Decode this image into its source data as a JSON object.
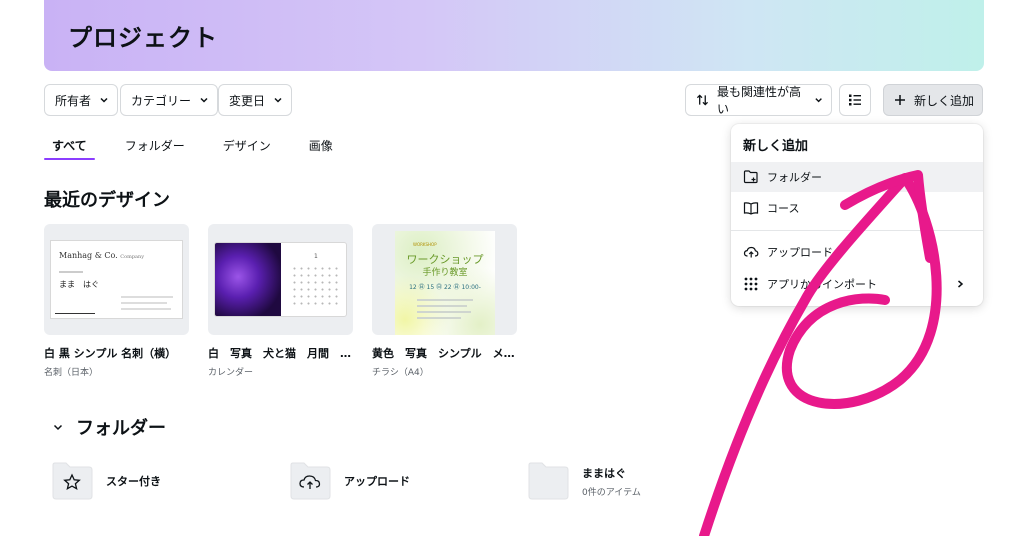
{
  "header": {
    "title": "プロジェクト"
  },
  "filters": {
    "owner": "所有者",
    "category": "カテゴリー",
    "modified": "変更日"
  },
  "sort": {
    "label": "最も関連性が高い"
  },
  "toolbar": {
    "new_label": "新しく追加"
  },
  "tabs": [
    {
      "label": "すべて",
      "active": true
    },
    {
      "label": "フォルダー",
      "active": false
    },
    {
      "label": "デザイン",
      "active": false
    },
    {
      "label": "画像",
      "active": false
    }
  ],
  "recent": {
    "title": "最近のデザイン",
    "items": [
      {
        "title": "白 黒 シンプル 名刺（横）",
        "type": "名刺（日本）",
        "thumb": {
          "brand": "Manhag & Co.",
          "tagline": "Company",
          "name": "まま　はぐ"
        }
      },
      {
        "title": "白　写真　犬と猫　月間　…",
        "type": "カレンダー",
        "thumb": {
          "month": "1"
        }
      },
      {
        "title": "黄色　写真　シンプル　メ…",
        "type": "チラシ（A4）",
        "thumb": {
          "kicker": "WORKSHOP",
          "heading": "ワークショップ",
          "sub": "手作り教室",
          "dates": "12 ㊐ 15 ㊐ 22 ㊐ 10:00-"
        }
      }
    ]
  },
  "folders": {
    "title": "フォルダー",
    "items": [
      {
        "name": "スター付き",
        "sub": "",
        "icon": "star-icon"
      },
      {
        "name": "アップロード",
        "sub": "",
        "icon": "cloud-upload-icon"
      },
      {
        "name": "ままはぐ",
        "sub": "0件のアイテム",
        "icon": ""
      }
    ]
  },
  "menu": {
    "title": "新しく追加",
    "items": [
      {
        "label": "フォルダー",
        "icon": "folder-plus-icon",
        "highlighted": true
      },
      {
        "label": "コース",
        "icon": "book-icon",
        "highlighted": false
      },
      {
        "label": "アップロード",
        "icon": "cloud-upload-icon",
        "highlighted": false
      },
      {
        "label": "アプリからインポート",
        "icon": "grid-icon",
        "highlighted": false
      }
    ]
  },
  "colors": {
    "accent": "#8b3dff",
    "annotation": "#e8198b"
  }
}
